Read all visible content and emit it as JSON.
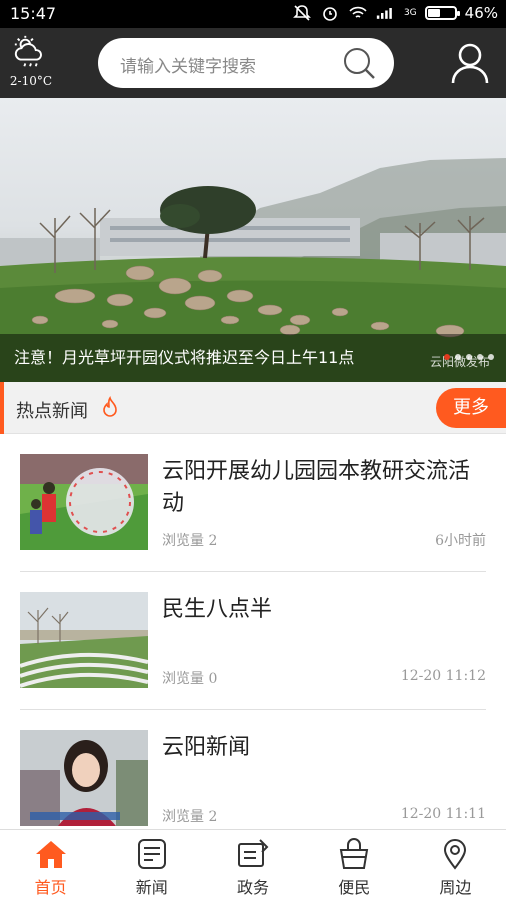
{
  "status_bar": {
    "time": "15:47",
    "battery": "46%",
    "network": "3G",
    "battery_level": 0.46
  },
  "header": {
    "weather_temp": "2-10°C",
    "search_placeholder": "请输入关键字搜索"
  },
  "banner": {
    "caption": "注意！月光草坪开园仪式将推迟至今日上午11点",
    "watermark": "云阳微发布",
    "slide_count": 5,
    "active_slide": 1
  },
  "hot_news": {
    "title": "热点新闻",
    "more_label": "更多"
  },
  "news": [
    {
      "title": "云阳开展幼儿园园本教研交流活动",
      "views": "浏览量 2",
      "time": "6小时前"
    },
    {
      "title": "民生八点半",
      "views": "浏览量 0",
      "time": "12-20 11:12"
    },
    {
      "title": "云阳新闻",
      "views": "浏览量 2",
      "time": "12-20 11:11"
    }
  ],
  "bottom_nav": [
    {
      "label": "首页",
      "icon": "home-icon",
      "active": true
    },
    {
      "label": "新闻",
      "icon": "news-icon"
    },
    {
      "label": "政务",
      "icon": "government-icon"
    },
    {
      "label": "便民",
      "icon": "convenience-icon"
    },
    {
      "label": "周边",
      "icon": "location-pin-icon"
    }
  ],
  "colors": {
    "accent": "#ff5a1f",
    "header_bg": "#2b2b2b",
    "active_dot": "#e03a1e"
  }
}
